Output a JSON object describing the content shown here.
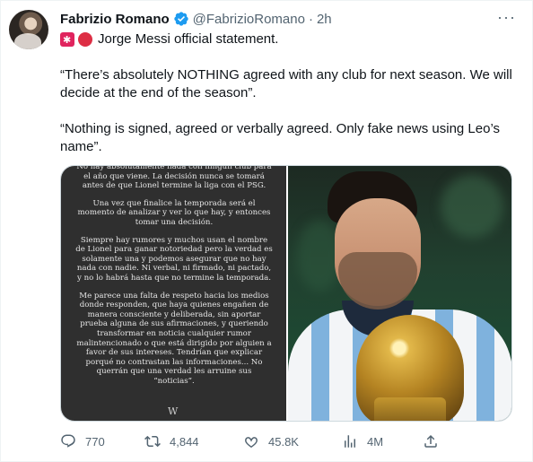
{
  "author": {
    "name": "Fabrizio Romano",
    "handle": "@FabrizioRomano",
    "separator": "·",
    "time": "2h",
    "verified_color": "#1d9bf0"
  },
  "tweet": {
    "line1": "Jorge Messi official statement.",
    "quote1": "“There’s absolutely NOTHING agreed with any club for next season. We will decide at the end of the season”.",
    "quote2": "“Nothing is signed, agreed or verbally agreed. Only fake news using Leo’s name”."
  },
  "image_statement": {
    "p1": "No hay absolutamente nada con ningún club para el año que viene. La decisión nunca se tomará antes de que Lionel termine la liga con el PSG.",
    "p2": "Una vez que finalice la temporada será el momento de analizar y ver lo que hay, y entonces tomar una decisión.",
    "p3": "Siempre hay rumores y muchos usan el nombre de Lionel para ganar notoriedad pero la verdad es solamente una y podemos asegurar que no hay nada con nadie. Ni verbal, ni firmado, ni pactado, y no lo habrá hasta que no termine la temporada.",
    "p4": "Me parece una falta de respeto hacia los medios donde responden, que haya quienes engañen de manera consciente y deliberada, sin aportar prueba alguna de sus afirmaciones, y queriendo transformar en noticia cualquier rumor malintencionado o que está dirigido por alguien a favor de sus intereses. Tendrían que explicar porqué no contrastan las informaciones... No querrán que una verdad les arruine sus “noticias”."
  },
  "actions": {
    "replies": "770",
    "retweets": "4,844",
    "likes": "45.8K",
    "views": "4M"
  },
  "icons": {
    "more": "more-icon",
    "reply": "reply-icon",
    "retweet": "retweet-icon",
    "like": "heart-icon",
    "views": "views-icon",
    "share": "share-icon"
  }
}
